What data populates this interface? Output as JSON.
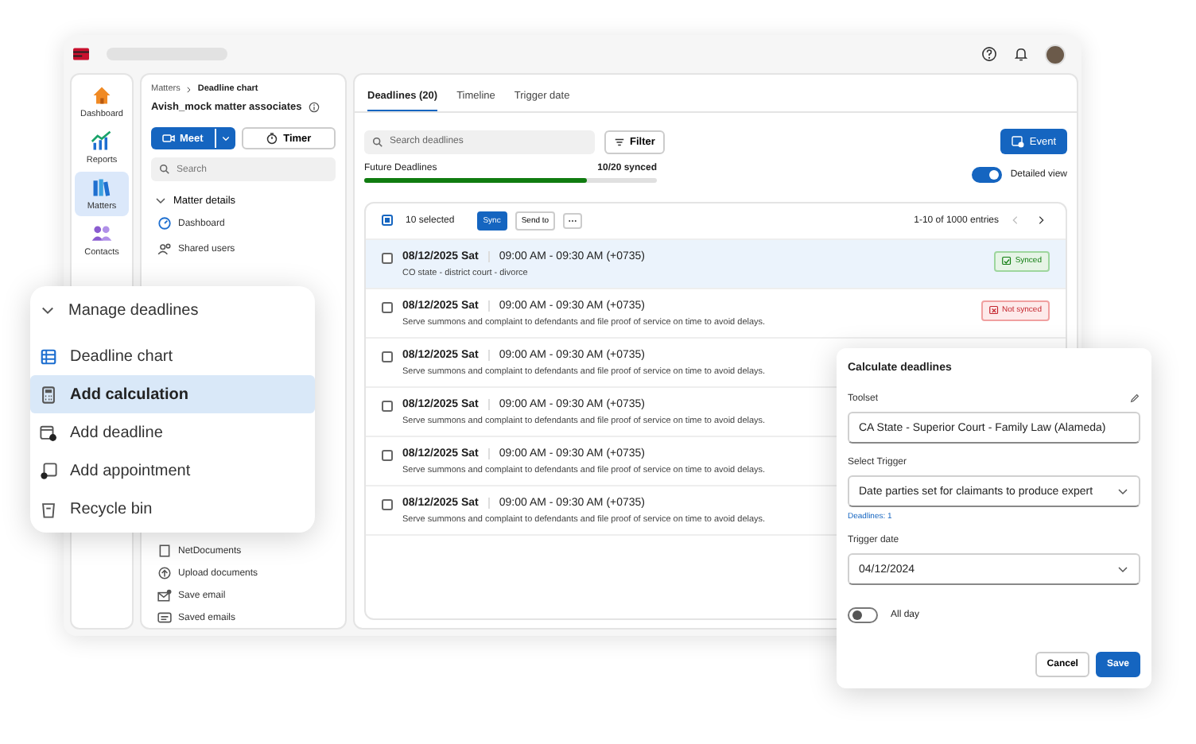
{
  "nav_rail": [
    {
      "label": "Dashboard",
      "kind": "home",
      "selected": false
    },
    {
      "label": "Reports",
      "kind": "reports",
      "selected": false
    },
    {
      "label": "Matters",
      "kind": "matters",
      "selected": true
    },
    {
      "label": "Contacts",
      "kind": "contacts",
      "selected": false
    }
  ],
  "matter_panel": {
    "breadcrumb": [
      "Matters",
      "Deadline chart"
    ],
    "title": "Avish_mock matter associates",
    "meet_button": "Meet",
    "timer_button": "Timer",
    "search_placeholder": "Search",
    "section": {
      "label": "Matter details",
      "expanded": true
    },
    "items": [
      {
        "label": "Dashboard",
        "kind": "dashboard"
      },
      {
        "label": "Shared users",
        "kind": "users"
      }
    ],
    "lower_items": [
      {
        "label": "NetDocuments",
        "kind": "document"
      },
      {
        "label": "Upload documents",
        "kind": "upload"
      },
      {
        "label": "Save email",
        "kind": "save-email"
      },
      {
        "label": "Saved emails",
        "kind": "saved-emails"
      }
    ]
  },
  "tabs": [
    {
      "label": "Deadlines (20)",
      "selected": true
    },
    {
      "label": "Timeline",
      "selected": false
    },
    {
      "label": "Trigger date",
      "selected": false
    }
  ],
  "toolbar": {
    "search_placeholder": "Search deadlines",
    "filter_button": "Filter",
    "event_button": "Event"
  },
  "sync_progress": {
    "label": "Future Deadlines",
    "reading": "10/20 synced",
    "level": 0.76
  },
  "detailed_view": {
    "label": "Detailed view",
    "on": true
  },
  "list_header": {
    "selection_label": "10 selected",
    "checked": true,
    "actions": [
      {
        "label": "Sync",
        "kind": "primary"
      },
      {
        "label": "Send to",
        "kind": "secondary"
      }
    ],
    "range": "1-10 of 1000 entries",
    "pager": [
      {
        "kind": "prev",
        "disabled": true
      },
      {
        "kind": "next",
        "disabled": false
      }
    ]
  },
  "deadlines": [
    {
      "date": "08/12/2025 Sat",
      "time": "09:00 AM - 09:30 AM (+0735)",
      "description": "CO state - district court - divorce",
      "checked": false,
      "selected": true,
      "status": {
        "kind": "synced",
        "label": "Synced"
      }
    },
    {
      "date": "08/12/2025 Sat",
      "time": "09:00 AM - 09:30 AM (+0735)",
      "description": "Serve summons and complaint to defendants and file proof of service on time to avoid delays.",
      "checked": false,
      "selected": false,
      "status": {
        "kind": "not-synced",
        "label": "Not synced"
      }
    },
    {
      "date": "08/12/2025 Sat",
      "time": "09:00 AM - 09:30 AM (+0735)",
      "description": "Serve summons and complaint to defendants and file proof of service on time to avoid delays.",
      "checked": false,
      "selected": false
    },
    {
      "date": "08/12/2025 Sat",
      "time": "09:00 AM - 09:30 AM (+0735)",
      "description": "Serve summons and complaint to defendants and file proof of service on time to avoid delays.",
      "checked": false,
      "selected": false
    },
    {
      "date": "08/12/2025 Sat",
      "time": "09:00 AM - 09:30 AM (+0735)",
      "description": "Serve summons and complaint to defendants and file proof of service on time to avoid delays.",
      "checked": false,
      "selected": false
    },
    {
      "date": "08/12/2025 Sat",
      "time": "09:00 AM - 09:30 AM (+0735)",
      "description": "Serve summons and complaint to defendants and file proof of service on time to avoid delays.",
      "checked": false,
      "selected": false
    }
  ],
  "manage_menu": {
    "title": "Manage deadlines",
    "expanded": true,
    "items": [
      {
        "label": "Deadline chart",
        "kind": "chart",
        "selected": false
      },
      {
        "label": "Add calculation",
        "kind": "calculation",
        "selected": true
      },
      {
        "label": "Add deadline",
        "kind": "deadline",
        "selected": false
      },
      {
        "label": "Add appointment",
        "kind": "appointment",
        "selected": false
      },
      {
        "label": "Recycle bin",
        "kind": "recycle",
        "selected": false
      }
    ]
  },
  "calculate_panel": {
    "title": "Calculate deadlines",
    "toolset": {
      "label": "Toolset",
      "value": "CA State - Superior Court - Family Law (Alameda)"
    },
    "trigger": {
      "label": "Select Trigger",
      "value": "Date parties set for claimants to produce expert",
      "hint": "Deadlines: 1"
    },
    "trigger_date": {
      "label": "Trigger date",
      "value": "04/12/2024"
    },
    "all_day": {
      "label": "All day",
      "on": false
    },
    "buttons": [
      {
        "label": "Cancel",
        "kind": "secondary"
      },
      {
        "label": "Save",
        "kind": "primary"
      }
    ]
  }
}
